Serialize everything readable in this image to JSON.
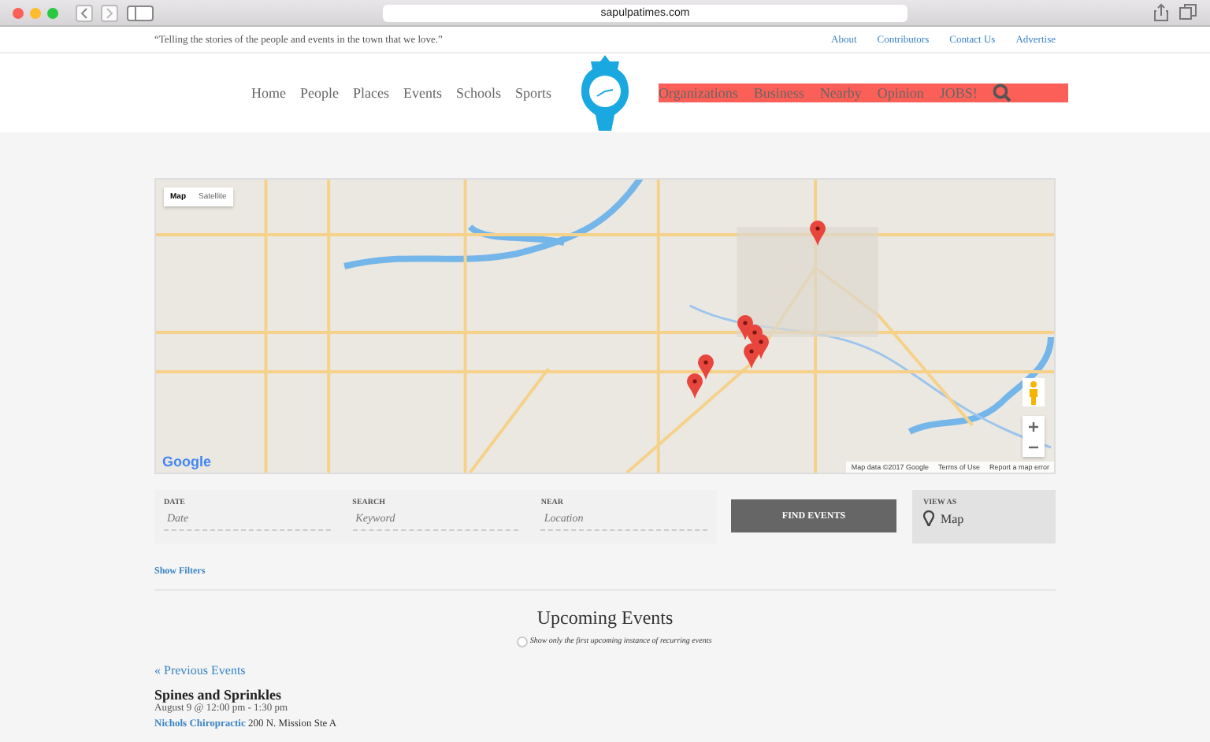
{
  "browser": {
    "url": "sapulpatimes.com"
  },
  "topbar": {
    "tagline": "“Telling the stories of the people and events in the town that we love.”",
    "links": [
      "About",
      "Contributors",
      "Contact Us",
      "Advertise"
    ]
  },
  "nav": {
    "left": [
      "Home",
      "People",
      "Places",
      "Events",
      "Schools",
      "Sports"
    ],
    "right": [
      "Organizations",
      "Business",
      "Nearby",
      "Opinion",
      "JOBS!"
    ]
  },
  "map": {
    "types": [
      {
        "label": "Map",
        "selected": true
      },
      {
        "label": "Satellite",
        "selected": false
      }
    ],
    "logo": "Google",
    "attribution": [
      "Map data ©2017 Google",
      "Terms of Use",
      "Report a map error"
    ]
  },
  "search": {
    "fields": [
      {
        "label": "DATE",
        "placeholder": "Date"
      },
      {
        "label": "SEARCH",
        "placeholder": "Keyword"
      },
      {
        "label": "NEAR",
        "placeholder": "Location"
      }
    ],
    "button": "FIND EVENTS",
    "view_as": {
      "label": "VIEW AS",
      "value": "Map"
    }
  },
  "show_filters": "Show Filters",
  "heading": "Upcoming Events",
  "recurring": {
    "label": "Show only the first upcoming instance of recurring events",
    "checked": false
  },
  "previous": "« Previous Events",
  "events": [
    {
      "title": "Spines and Sprinkles",
      "time": "August 9 @ 12:00 pm - 1:30 pm",
      "venue": "Nichols Chiropractic",
      "address": "200 N. Mission Ste A"
    }
  ]
}
